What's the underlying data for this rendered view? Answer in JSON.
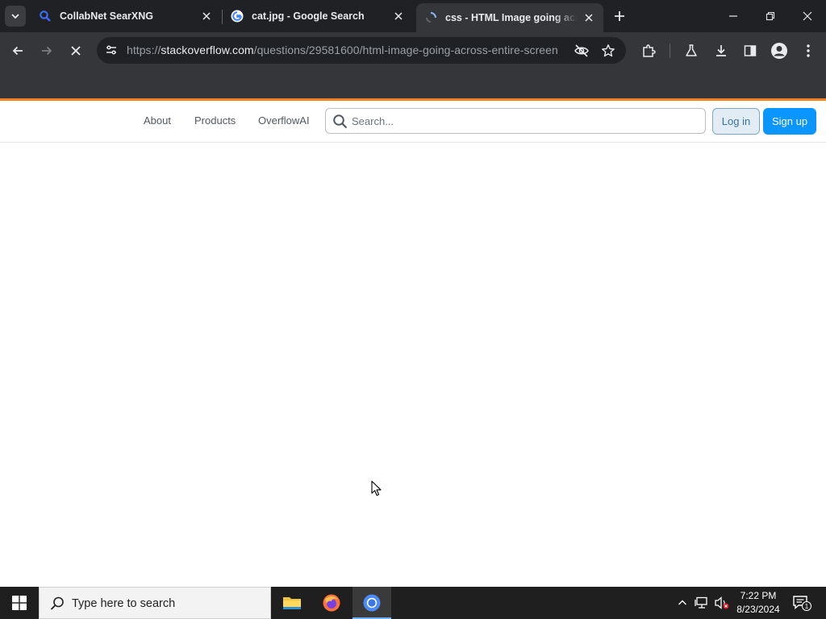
{
  "browser": {
    "tabs": [
      {
        "title": "CollabNet SearXNG",
        "icon": "searxng-magnifier-icon",
        "active": false
      },
      {
        "title": "cat.jpg - Google Search",
        "icon": "google-g-icon",
        "active": false
      },
      {
        "title": "css - HTML Image going across entire screen",
        "icon": "stackoverflow-loading-icon",
        "active": true
      }
    ],
    "url": {
      "scheme": "https://",
      "host": "stackoverflow.com",
      "path": "/questions/29581600/html-image-going-across-entire-screen"
    }
  },
  "page": {
    "nav": {
      "about": "About",
      "products": "Products",
      "overflow_ai": "OverflowAI"
    },
    "search": {
      "placeholder": "Search..."
    },
    "buttons": {
      "login": "Log in",
      "signup": "Sign up"
    },
    "colors": {
      "accent": "#f48024",
      "primary": "#0a95ff"
    }
  },
  "taskbar": {
    "search_placeholder": "Type here to search",
    "apps": [
      "file-explorer-icon",
      "firefox-icon",
      "chrome-icon"
    ],
    "clock": {
      "time": "7:22 PM",
      "date": "8/23/2024"
    },
    "notifications_count": "1"
  }
}
